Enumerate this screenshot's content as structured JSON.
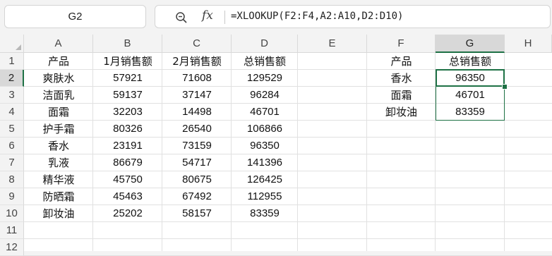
{
  "namebox": {
    "value": "G2"
  },
  "formula": {
    "zoom_icon": "zoom-icon",
    "fx_label": "fx",
    "text": "=XLOOKUP(F2:F4,A2:A10,D2:D10)"
  },
  "columns": [
    "A",
    "B",
    "C",
    "D",
    "E",
    "F",
    "G",
    "H"
  ],
  "rows": [
    "1",
    "2",
    "3",
    "4",
    "5",
    "6",
    "7",
    "8",
    "9",
    "10",
    "11",
    "12"
  ],
  "selected": {
    "column": "G",
    "row": "2"
  },
  "main_table": {
    "headers": [
      "产品",
      "1月销售额",
      "2月销售额",
      "总销售额"
    ],
    "rows": [
      [
        "爽肤水",
        "57921",
        "71608",
        "129529"
      ],
      [
        "洁面乳",
        "59137",
        "37147",
        "96284"
      ],
      [
        "面霜",
        "32203",
        "14498",
        "46701"
      ],
      [
        "护手霜",
        "80326",
        "26540",
        "106866"
      ],
      [
        "香水",
        "23191",
        "73159",
        "96350"
      ],
      [
        "乳液",
        "86679",
        "54717",
        "141396"
      ],
      [
        "精华液",
        "45750",
        "80675",
        "126425"
      ],
      [
        "防晒霜",
        "45463",
        "67492",
        "112955"
      ],
      [
        "卸妆油",
        "25202",
        "58157",
        "83359"
      ]
    ]
  },
  "lookup_table": {
    "headers": [
      "产品",
      "总销售额"
    ],
    "rows": [
      [
        "香水",
        "96350"
      ],
      [
        "面霜",
        "46701"
      ],
      [
        "卸妆油",
        "83359"
      ]
    ]
  },
  "colors": {
    "accent": "#1e7145",
    "header_bg": "#f3f3f3"
  }
}
